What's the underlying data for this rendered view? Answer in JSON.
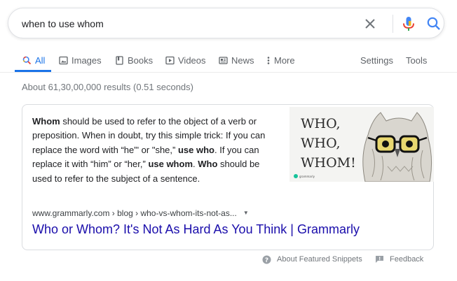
{
  "search": {
    "query": "when to use whom",
    "clear_icon": "close-icon",
    "mic_icon": "microphone-icon",
    "search_icon": "search-icon"
  },
  "tabs": [
    {
      "label": "All",
      "icon": "search-icon",
      "active": true
    },
    {
      "label": "Images",
      "icon": "image-icon"
    },
    {
      "label": "Books",
      "icon": "book-icon"
    },
    {
      "label": "Videos",
      "icon": "video-icon"
    },
    {
      "label": "News",
      "icon": "news-icon"
    },
    {
      "label": "More",
      "icon": "more-vertical-icon"
    }
  ],
  "tools": {
    "settings_label": "Settings",
    "tools_label": "Tools"
  },
  "result_stats": "About 61,30,00,000 results (0.51 seconds)",
  "snippet": {
    "segments": [
      {
        "text": "Whom",
        "bold": true
      },
      {
        "text": " should be used to refer to the object of a verb or preposition. When in doubt, try this simple trick: If you can replace the word with “he”' or \"she,” ",
        "bold": false
      },
      {
        "text": "use who",
        "bold": true
      },
      {
        "text": ". If you can replace it with “him” or “her,” ",
        "bold": false
      },
      {
        "text": "use whom",
        "bold": true
      },
      {
        "text": ". ",
        "bold": false
      },
      {
        "text": "Who",
        "bold": true
      },
      {
        "text": " should be used to refer to the subject of a sentence.",
        "bold": false
      }
    ],
    "image": {
      "lines": [
        "WHO,",
        "WHO,",
        "WHOM!"
      ],
      "brand": "grammarly"
    },
    "cite": "www.grammarly.com › blog › who-vs-whom-its-not-as...",
    "title": "Who or Whom? It's Not As Hard As You Think | Grammarly"
  },
  "footer": {
    "about_label": "About Featured Snippets",
    "feedback_label": "Feedback"
  },
  "colors": {
    "accent": "#1a73e8",
    "link": "#1a0dab",
    "mic_blue": "#4285f4",
    "mic_red": "#ea4335"
  }
}
